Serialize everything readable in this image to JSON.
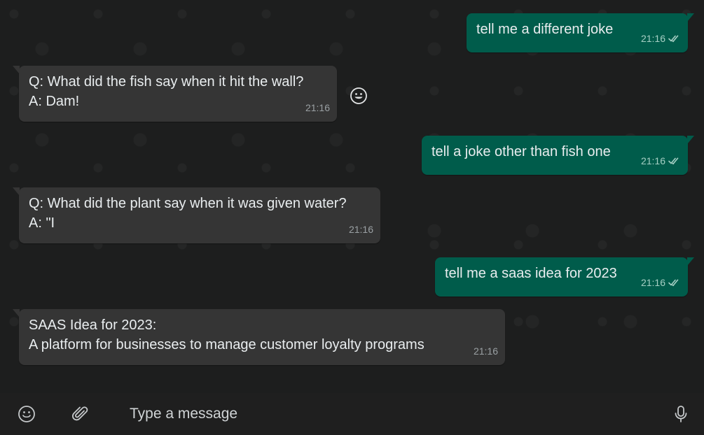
{
  "messages": [
    {
      "text": "tell me a different joke",
      "time": "21:16",
      "direction": "out",
      "status": "read"
    },
    {
      "text": "Q: What did the fish say when it hit the wall?\nA: Dam!",
      "time": "21:16",
      "direction": "in"
    },
    {
      "text": "tell a joke other than fish one",
      "time": "21:16",
      "direction": "out",
      "status": "read"
    },
    {
      "text": "Q: What did the plant say when it was given water?\nA: \"I",
      "time": "21:16",
      "direction": "in"
    },
    {
      "text": "tell me a saas idea for 2023",
      "time": "21:16",
      "direction": "out",
      "status": "read"
    },
    {
      "text": "SAAS Idea for 2023:\nA platform for businesses to manage customer loyalty programs",
      "time": "21:16",
      "direction": "in"
    }
  ],
  "composer": {
    "placeholder": "Type a message",
    "icons": [
      "emoji-icon",
      "attach-icon",
      "microphone-icon"
    ]
  },
  "reaction_icon": "emoji-react-icon",
  "colors": {
    "outgoing_bubble": "#005c4b",
    "incoming_bubble": "#353535",
    "background": "#1d1e1e",
    "composer_bg": "#1f1f1f"
  }
}
